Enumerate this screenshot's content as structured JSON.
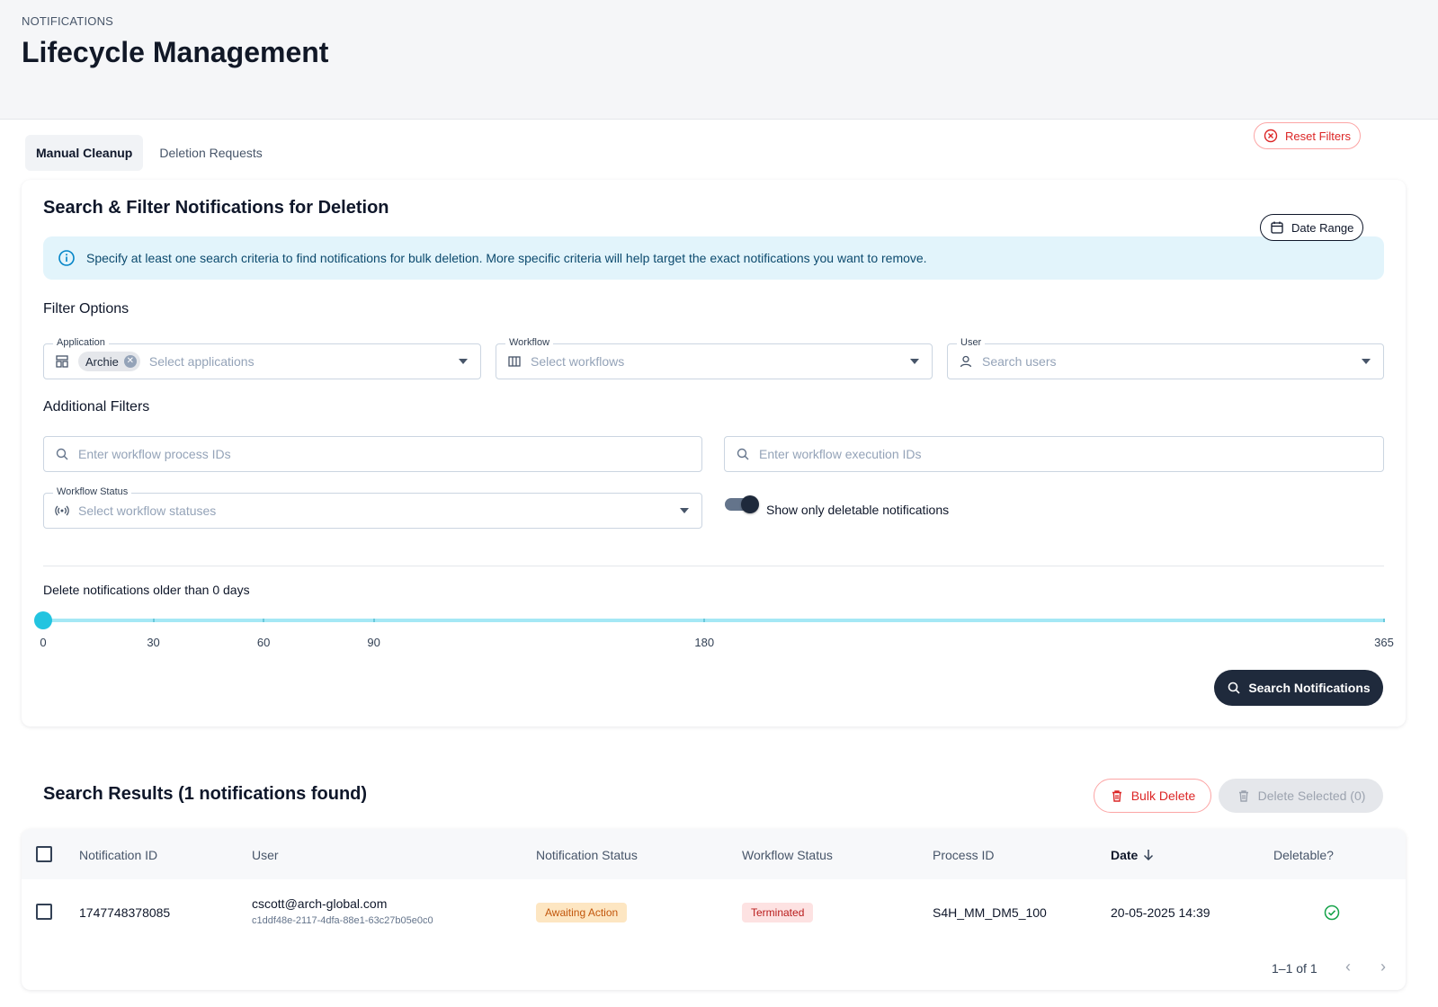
{
  "header": {
    "eyebrow": "NOTIFICATIONS",
    "title": "Lifecycle Management"
  },
  "tabs": [
    {
      "label": "Manual Cleanup",
      "active": true
    },
    {
      "label": "Deletion Requests",
      "active": false
    }
  ],
  "filter_card": {
    "title": "Search & Filter Notifications for Deletion",
    "info": "Specify at least one search criteria to find notifications for bulk deletion. More specific criteria will help target the exact notifications you want to remove.",
    "filter_options_label": "Filter Options",
    "reset_label": "Reset Filters",
    "application": {
      "label": "Application",
      "chip": "Archie",
      "placeholder": "Select applications"
    },
    "workflow": {
      "label": "Workflow",
      "placeholder": "Select workflows"
    },
    "user": {
      "label": "User",
      "placeholder": "Search users"
    },
    "additional_filters_label": "Additional Filters",
    "date_range_label": "Date Range",
    "process_ids_placeholder": "Enter workflow process IDs",
    "execution_ids_placeholder": "Enter workflow execution IDs",
    "workflow_status": {
      "label": "Workflow Status",
      "placeholder": "Select workflow statuses"
    },
    "deletable_toggle": {
      "label": "Show only deletable notifications",
      "on": true
    },
    "slider": {
      "label": "Delete notifications older than 0 days",
      "value": 0,
      "min": 0,
      "max": 365,
      "marks": [
        "0",
        "30",
        "60",
        "90",
        "180",
        "365"
      ]
    },
    "search_button": "Search Notifications"
  },
  "results": {
    "title": "Search Results (1 notifications found)",
    "bulk_delete": "Bulk Delete",
    "delete_selected": "Delete Selected (0)",
    "columns": [
      "Notification ID",
      "User",
      "Notification Status",
      "Workflow Status",
      "Process ID",
      "Date",
      "Deletable?"
    ],
    "rows": [
      {
        "notification_id": "1747748378085",
        "user_email": "cscott@arch-global.com",
        "user_id": "c1ddf48e-2117-4dfa-88e1-63c27b05e0c0",
        "notification_status": "Awaiting Action",
        "workflow_status": "Terminated",
        "process_id": "S4H_MM_DM5_100",
        "date": "20-05-2025 14:39",
        "deletable": true
      }
    ],
    "pagination": "1–1 of 1"
  },
  "colors": {
    "accent": "#22c4e0",
    "danger": "#dc2626",
    "dark_button": "#1f2a3c",
    "success": "#16a34a"
  }
}
